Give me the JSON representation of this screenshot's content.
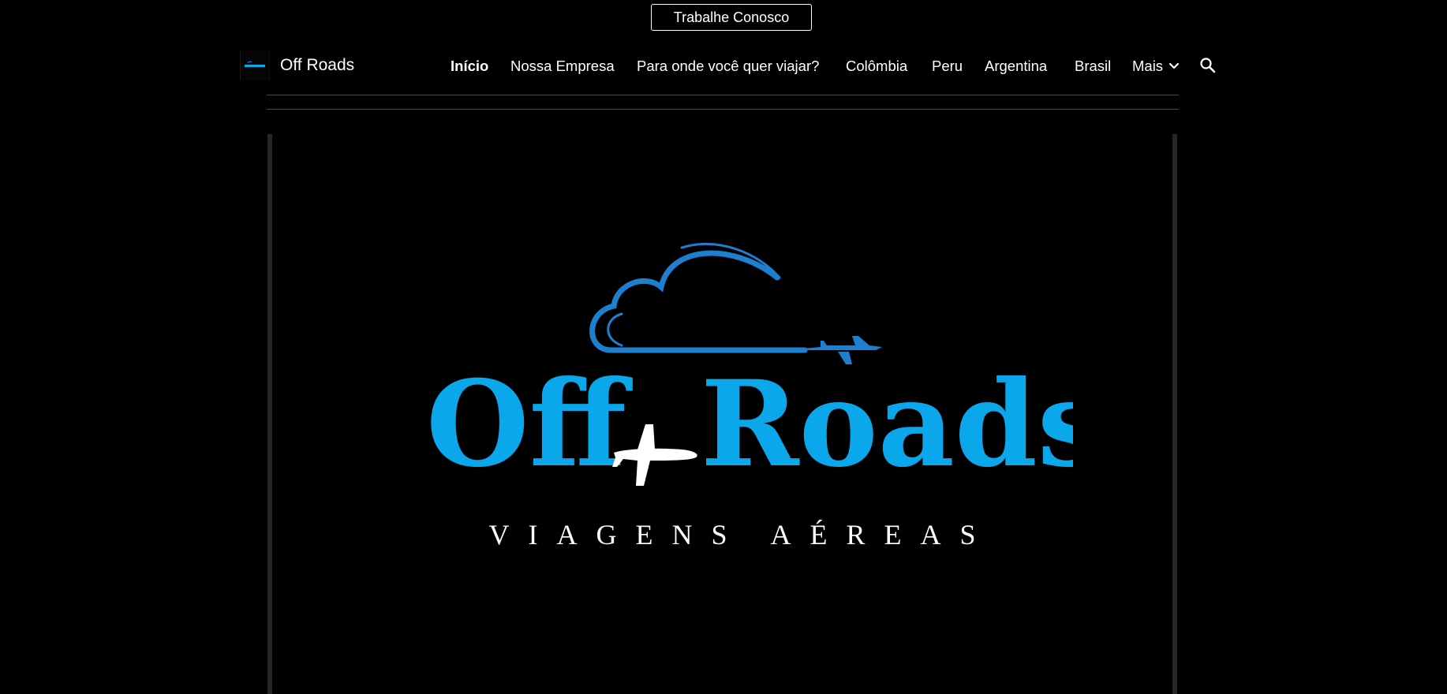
{
  "cta": {
    "label": "Trabalhe Conosco"
  },
  "site": {
    "title": "Off Roads",
    "logo_thumb_text": "Off Roads"
  },
  "nav": {
    "items": [
      {
        "label": "Início",
        "active": true
      },
      {
        "label": "Nossa Empresa",
        "active": false
      },
      {
        "label": "Para onde você quer viajar?",
        "active": false
      },
      {
        "label": "Colômbia",
        "active": false
      },
      {
        "label": "Peru",
        "active": false
      },
      {
        "label": "Argentina",
        "active": false
      },
      {
        "label": "Brasil",
        "active": false
      },
      {
        "label": "Mais",
        "active": false
      }
    ],
    "more_icon": "chevron-down-icon",
    "search_icon": "search-icon"
  },
  "hero": {
    "brand_left": "Off",
    "brand_right": "Roads",
    "tagline": "VIAGENS AÉREAS",
    "icons": [
      "cloud-icon",
      "airplane-icon"
    ]
  },
  "colors": {
    "background": "#000000",
    "brand_blue": "#0aa7ea",
    "cloud_blue": "#1e7fcf",
    "text": "#ffffff",
    "divider": "#4a4a4a",
    "frame": "#262626"
  }
}
